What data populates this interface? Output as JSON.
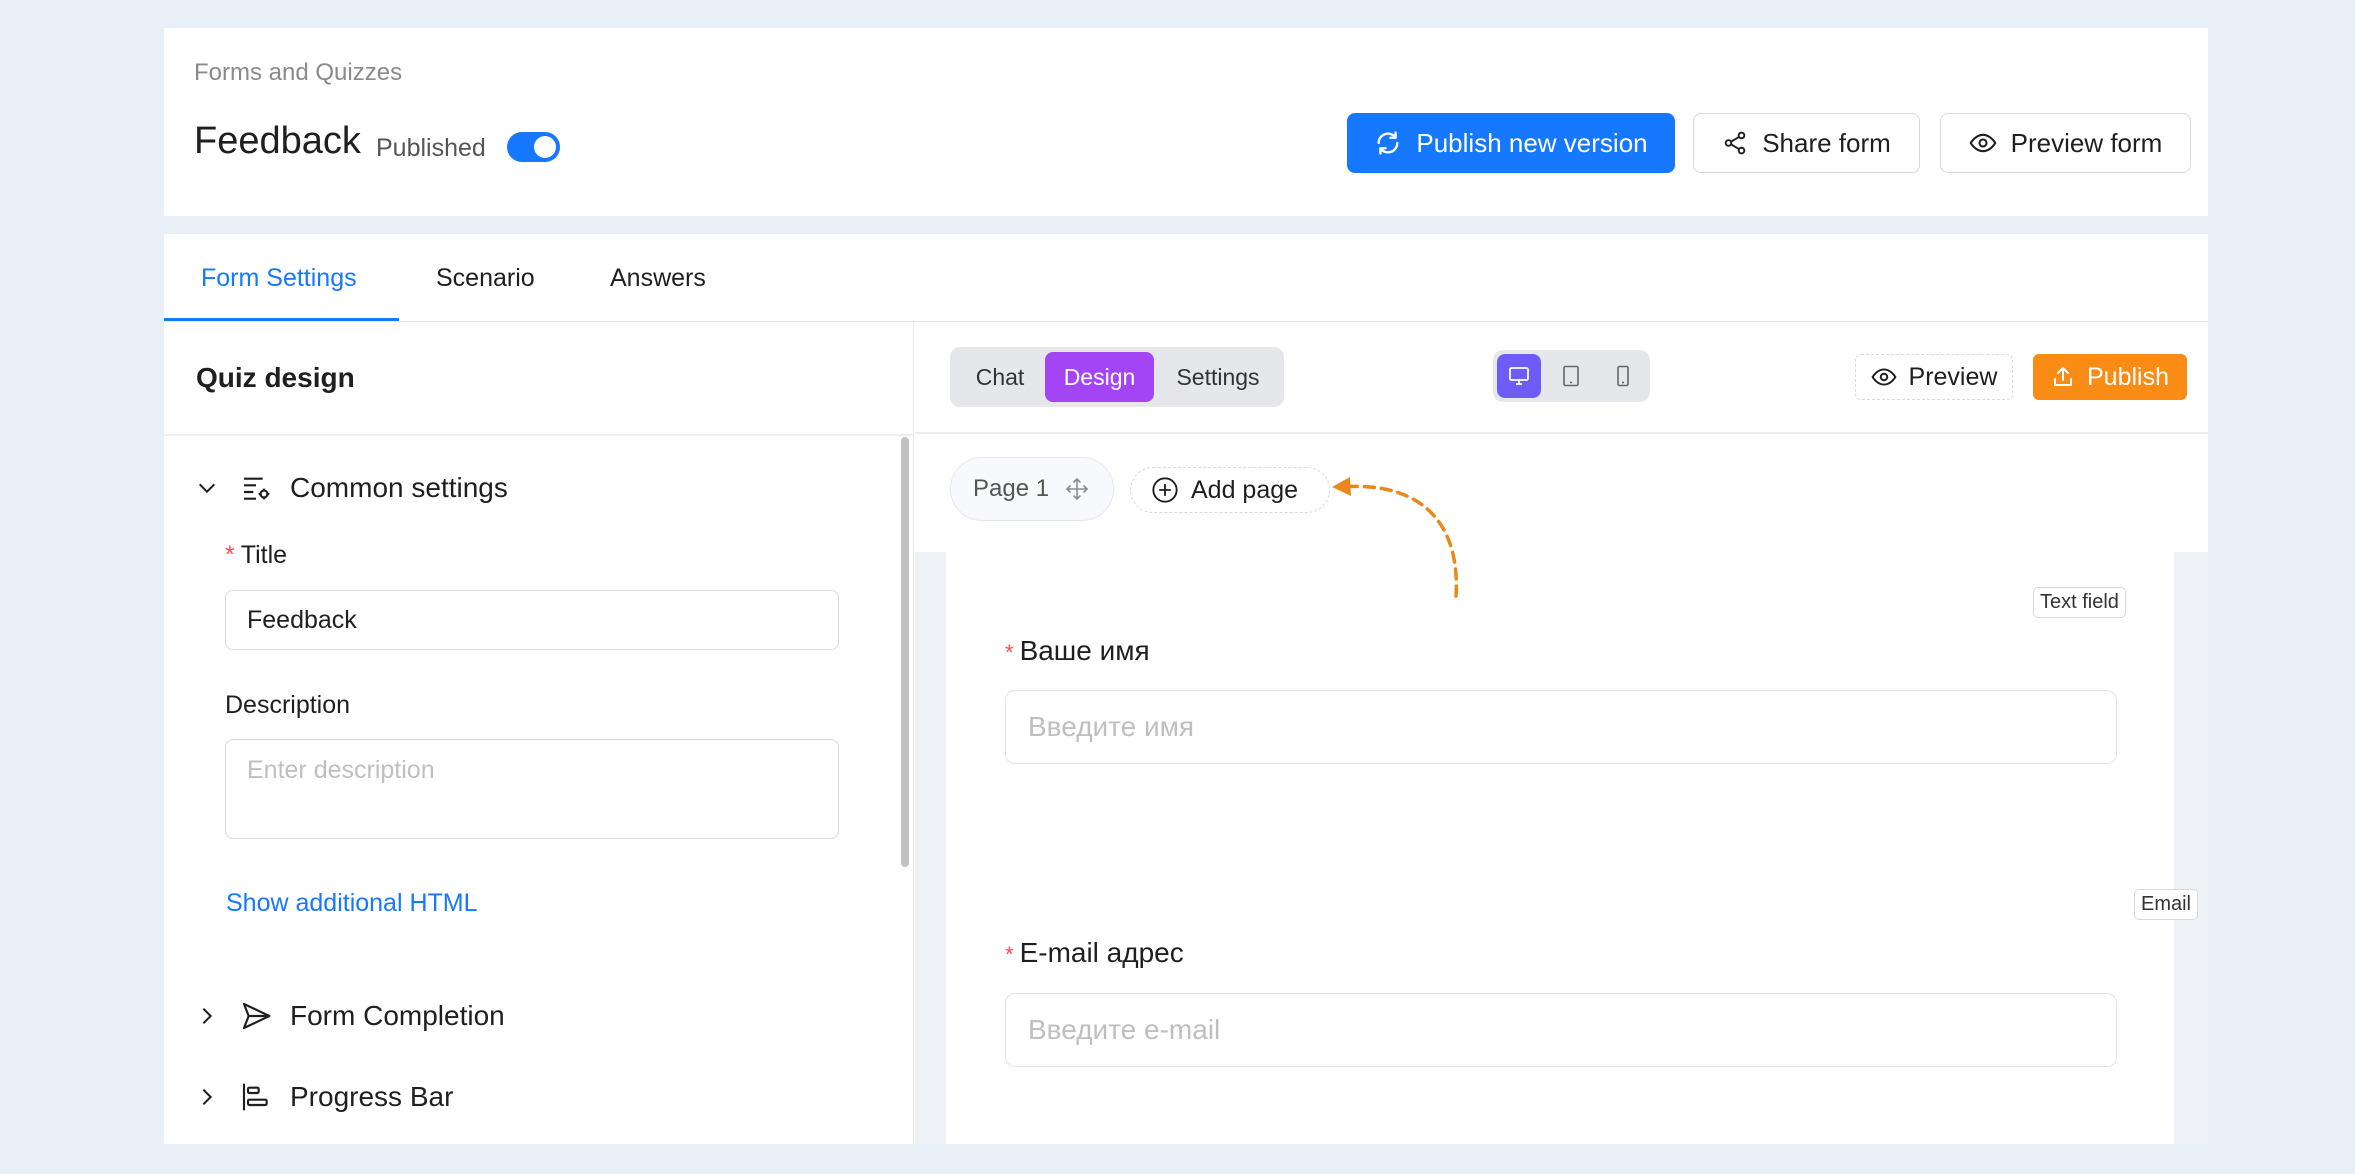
{
  "header": {
    "breadcrumb": "Forms and Quizzes",
    "title": "Feedback",
    "status_label": "Published",
    "published": true,
    "buttons": {
      "publish_new_version": "Publish new version",
      "share_form": "Share form",
      "preview_form": "Preview form"
    }
  },
  "tabs": [
    {
      "label": "Form Settings",
      "active": true
    },
    {
      "label": "Scenario",
      "active": false
    },
    {
      "label": "Answers",
      "active": false
    }
  ],
  "left_panel": {
    "title": "Quiz design",
    "sections": {
      "common": "Common settings",
      "completion": "Form Completion",
      "progress": "Progress Bar"
    },
    "fields": {
      "title_label": "Title",
      "title_value": "Feedback",
      "description_label": "Description",
      "description_placeholder": "Enter description",
      "additional_html_link": "Show additional HTML"
    }
  },
  "editor": {
    "modes": [
      {
        "label": "Chat",
        "active": false
      },
      {
        "label": "Design",
        "active": true
      },
      {
        "label": "Settings",
        "active": false
      }
    ],
    "devices": {
      "desktop": "active",
      "tablet": "inactive",
      "mobile": "inactive"
    },
    "preview_button": "Preview",
    "publish_button": "Publish",
    "page_pill": "Page 1",
    "add_page": "Add page"
  },
  "questions": [
    {
      "type_badge": "Text field",
      "label": "Ваше имя",
      "placeholder": "Введите имя",
      "required": true
    },
    {
      "type_badge": "Email",
      "label": "E-mail адрес",
      "placeholder": "Введите e-mail",
      "required": true
    }
  ],
  "colors": {
    "primary": "#1677ff",
    "design_accent": "#a445f5",
    "device_accent": "#6d5cf6",
    "publish_orange": "#fa8c16",
    "annotation_arrow": "#e9891c",
    "required": "#ff4d4f"
  }
}
